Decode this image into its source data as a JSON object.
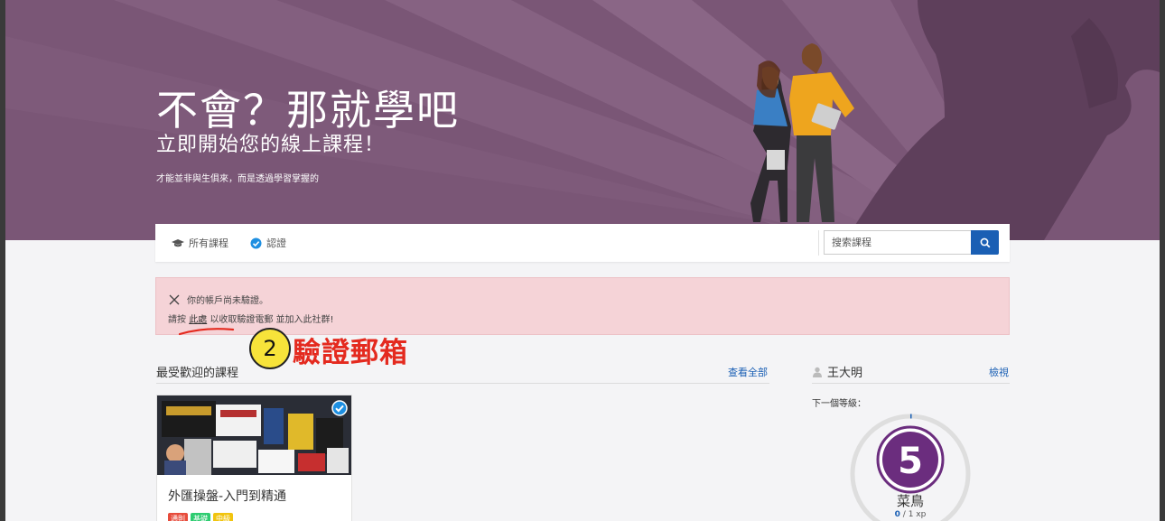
{
  "hero": {
    "title": "不會？那就學吧",
    "subtitle": "立即開始您的線上課程！",
    "description": "才能並非與生俱來，而是透過學習掌握的"
  },
  "nav": {
    "all_courses": "所有課程",
    "certification": "認證",
    "search_placeholder": "搜索課程"
  },
  "alert": {
    "line1": "你的帳戶尚未驗證。",
    "line2_prefix": "請按",
    "line2_link": "此處",
    "line2_suffix": "以收取驗證電郵 並加入此社群!"
  },
  "annotation": {
    "number": "2",
    "text": "驗證郵箱"
  },
  "popular": {
    "title": "最受歡迎的課程",
    "view_all": "查看全部",
    "courses": [
      {
        "title": "外匯操盤-入門到精通",
        "tags": [
          {
            "label": "通則",
            "color": "#e74c3c"
          },
          {
            "label": "基礎",
            "color": "#2ecc71"
          },
          {
            "label": "中級",
            "color": "#f1c40f"
          }
        ]
      }
    ]
  },
  "profile": {
    "name": "王大明",
    "view": "檢視",
    "next_level": "下一個等級：",
    "level": "5",
    "rank": "菜鳥",
    "xp_current": "0",
    "xp_sep": " / ",
    "xp_total": "1",
    "xp_unit": " xp",
    "progress": 0
  },
  "colors": {
    "hero_bg": "#7a5676",
    "accent": "#1a5fb4",
    "level_purple": "#6b2d7e",
    "alert_bg": "#f5d3d7",
    "annotation_red": "#e42a1f",
    "annotation_yellow": "#f7e33a"
  }
}
